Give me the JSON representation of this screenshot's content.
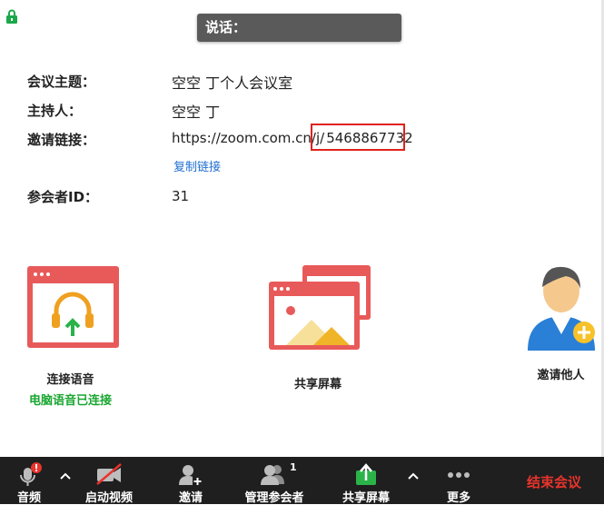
{
  "speaking": {
    "label": "说话："
  },
  "meeting": {
    "topic_label": "会议主题：",
    "topic_value": "空空 丁个人会议室",
    "host_label": "主持人：",
    "host_value": "空空 丁",
    "invite_label": "邀请链接：",
    "invite_url_prefix": "https://zoom.com.cn/j/",
    "invite_url_id": "5468867732",
    "copy_link": "复制链接",
    "participant_id_label": "参会者ID：",
    "participant_id_value": "31"
  },
  "actions": {
    "join_audio": "连接语音",
    "audio_status": "电脑语音已连接",
    "share_screen": "共享屏幕",
    "invite_others": "邀请他人"
  },
  "toolbar": {
    "audio": "音频",
    "start_video": "启动视频",
    "invite": "邀请",
    "manage_participants": "管理参会者",
    "participant_count": "1",
    "share_screen": "共享屏幕",
    "more": "更多",
    "end_meeting": "结束会议"
  },
  "colors": {
    "accent_red": "#e8342c",
    "link_blue": "#1f6fd0",
    "status_green": "#19a630",
    "toolbar_bg": "#1f1f1f"
  }
}
